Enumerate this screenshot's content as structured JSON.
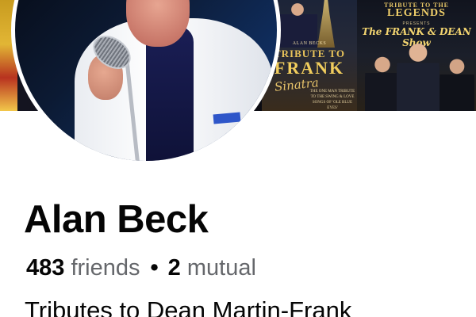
{
  "cover": {
    "poster_left": {
      "presenter": "ALAN BECKS",
      "title_line1": "TRIBUTE TO",
      "title_line2": "FRANK",
      "script": "Sinatra",
      "tagline": "THE ONE MAN TRIBUTE TO THE SWING & LOVE SONGS OF 'OLE BLUE EYES'"
    },
    "poster_right": {
      "pre": "TRIBUTE TO THE",
      "title": "LEGENDS",
      "presents": "PRESENTS",
      "show": "The FRANK & DEAN Show"
    }
  },
  "profile": {
    "name": "Alan Beck",
    "friends_count": "483",
    "friends_label": "friends",
    "separator": "•",
    "mutual_count": "2",
    "mutual_label": "mutual",
    "bio": "Tributes to Dean Martin-Frank"
  },
  "colors": {
    "text_primary": "#050505",
    "text_secondary": "#65676b",
    "background": "#ffffff"
  }
}
